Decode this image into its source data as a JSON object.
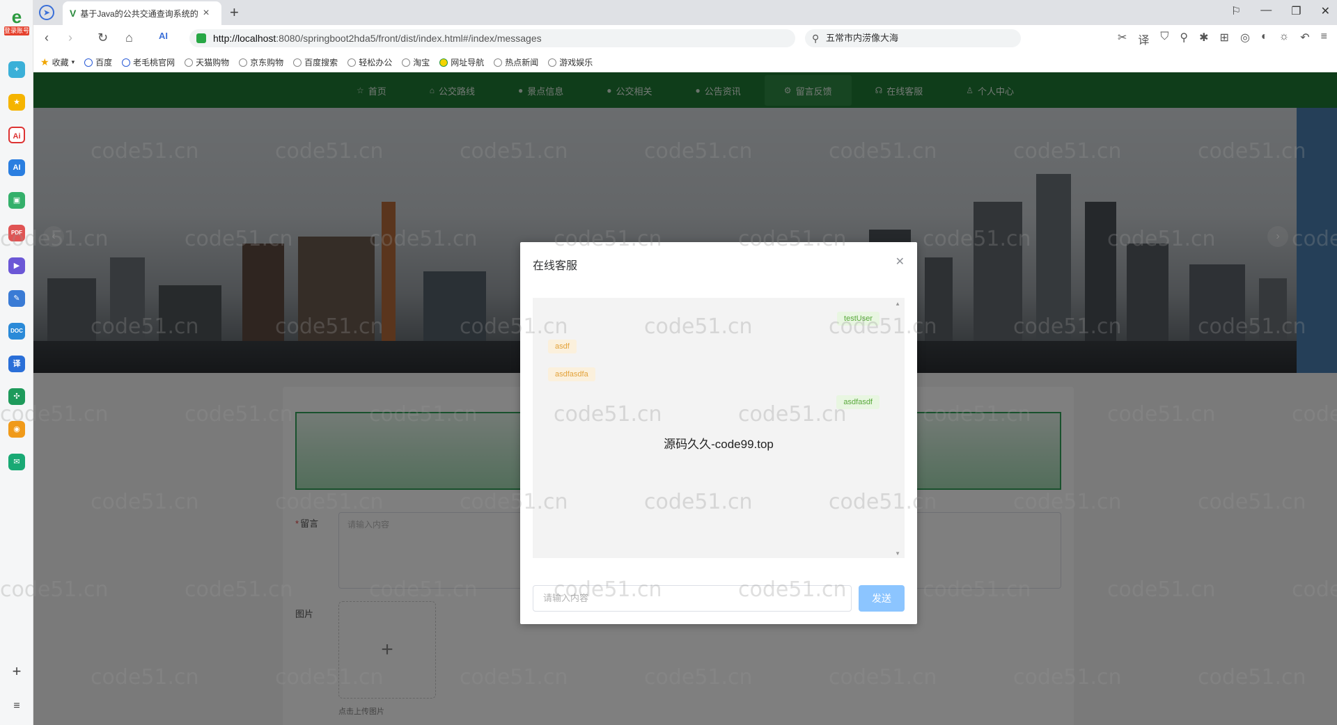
{
  "browser": {
    "tab_title": "基于Java的公共交通查询系统的",
    "url_host": "http://localhost",
    "url_rest": ":8080/springboot2hda5/front/dist/index.html#/index/messages",
    "search_text": "五常市内涝像大海",
    "left_tag": "登录账号",
    "bookmarks": [
      "收藏",
      "百度",
      "老毛桃官网",
      "天猫购物",
      "京东购物",
      "百度搜索",
      "轻松办公",
      "淘宝",
      "网址导航",
      "热点新闻",
      "游戏娱乐"
    ]
  },
  "nav": {
    "items": [
      {
        "label": "首页",
        "icon": "star-icon"
      },
      {
        "label": "公交路线",
        "icon": "bus-icon"
      },
      {
        "label": "景点信息",
        "icon": "info-icon"
      },
      {
        "label": "公交相关",
        "icon": "info-icon"
      },
      {
        "label": "公告资讯",
        "icon": "info-icon"
      },
      {
        "label": "留言反馈",
        "icon": "gear-icon"
      },
      {
        "label": "在线客服",
        "icon": "headset-icon"
      },
      {
        "label": "个人中心",
        "icon": "user-icon"
      }
    ],
    "active_index": 5
  },
  "form": {
    "message_label": "留言",
    "message_placeholder": "请输入内容",
    "image_label": "图片",
    "upload_tip": "点击上传图片"
  },
  "modal": {
    "title": "在线客服",
    "messages": [
      {
        "side": "right",
        "text": "testUser"
      },
      {
        "side": "left",
        "text": "asdf"
      },
      {
        "side": "left",
        "text": "asdfasdfa"
      },
      {
        "side": "right",
        "text": "asdfasdf"
      }
    ],
    "overlay_text": "源码久久-code99.top",
    "input_placeholder": "请输入内容",
    "send_label": "发送"
  },
  "watermark": "code51.cn",
  "colors": {
    "nav_bg": "#1f7a34",
    "send_btn": "#8cc5ff",
    "right_bubble": "#e8f6e1",
    "left_bubble": "#fbf0dc"
  }
}
